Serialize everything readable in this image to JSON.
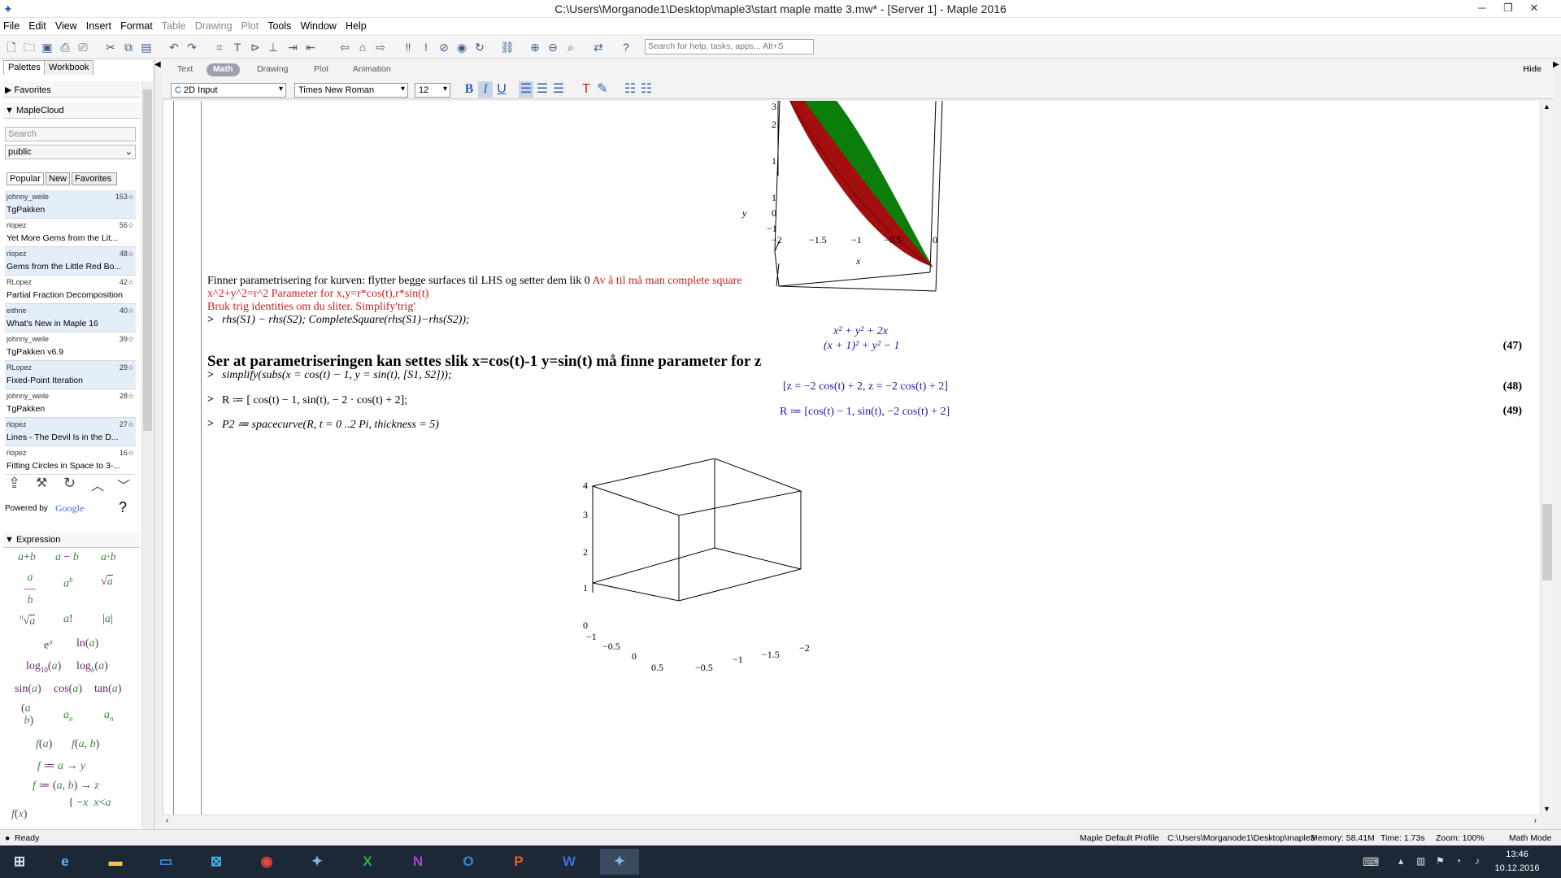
{
  "window": {
    "title": "C:\\Users\\Morganode1\\Desktop\\maple3\\start maple matte 3.mw* - [Server 1] - Maple 2016",
    "minimize": "─",
    "restore": "❐",
    "close": "✕"
  },
  "menu": [
    "File",
    "Edit",
    "View",
    "Insert",
    "Format",
    "Table",
    "Drawing",
    "Plot",
    "Tools",
    "Window",
    "Help"
  ],
  "toolbar": {
    "search_placeholder": "Search for help, tasks, apps... Alt+S"
  },
  "palette": {
    "tabs": [
      "Palettes",
      "Workbook"
    ],
    "favorites_label": "Favorites",
    "maplecloud_label": "MapleCloud",
    "search_placeholder": "Search",
    "group_select": "public",
    "cloud_tabs": [
      "Popular",
      "New",
      "Favorites"
    ],
    "cloud_items": [
      {
        "author": "johnny_weile",
        "count": "153",
        "name": "TgPakken"
      },
      {
        "author": "rlopez",
        "count": "56",
        "name": "Yet More Gems from the Lit..."
      },
      {
        "author": "rlopez",
        "count": "48",
        "name": "Gems from the Little Red Bo..."
      },
      {
        "author": "RLopez",
        "count": "42",
        "name": "Partial Fraction Decomposition"
      },
      {
        "author": "eithne",
        "count": "40",
        "name": "What's New in Maple 16"
      },
      {
        "author": "johnny_weile",
        "count": "39",
        "name": "TgPakken v6.9"
      },
      {
        "author": "RLopez",
        "count": "29",
        "name": "Fixed-Point Iteration"
      },
      {
        "author": "johnny_weile",
        "count": "28",
        "name": "TgPakken"
      },
      {
        "author": "rlopez",
        "count": "27",
        "name": "Lines - The Devil Is in the D..."
      },
      {
        "author": "rlopez",
        "count": "16",
        "name": "Fitting Circles in Space to 3-..."
      }
    ],
    "powered_by": "Powered by",
    "google": "Google",
    "help_mark": "?",
    "expression_label": "Expression"
  },
  "context": {
    "modes": [
      "Text",
      "Math",
      "Drawing",
      "Plot",
      "Animation"
    ],
    "active_mode": "Math",
    "hide_label": "Hide",
    "input_style": "2D Input",
    "font": "Times New Roman",
    "size": "12",
    "bold": "B",
    "italic": "I",
    "underline": "U"
  },
  "document": {
    "plot1": {
      "ylabel": "y",
      "xlabel": "x",
      "z_ticks": [
        "3",
        "2",
        "1"
      ],
      "y_ticks": [
        "1",
        "0",
        "−1"
      ],
      "x_ticks": [
        "−2",
        "−1.5",
        "−1",
        "−0.5",
        "0"
      ]
    },
    "text_line1_black": "Finner parametrisering for kurven: flytter begge surfaces til LHS og setter dem lik 0 ",
    "text_line1_red": "Av å til må man complete square",
    "text_line2": "x^2+y^2=r^2 Parameter for x,y=r*cos(t),r*sin(t)",
    "text_line3": "Bruk trig identities om du sliter. Simplify'trig'",
    "prompt_symbol": ">",
    "input1": "rhs(S1) − rhs(S2); CompleteSquare(rhs(S1)−rhs(S2));",
    "output1a": "x² + y² + 2x",
    "output1b": "(x + 1)² + y² − 1",
    "eq47": "(47)",
    "heading": "Ser at parametriseringen kan settes slik x=cos(t)-1    y=sin(t) må finne parameter for z",
    "input2": "simplify(subs(x = cos(t) − 1, y = sin(t), [S1, S2]));",
    "output2": "[z = −2 cos(t) + 2, z = −2 cos(t) + 2]",
    "eq48": "(48)",
    "input3": "R ≔ [ cos(t) − 1, sin(t), − 2 · cos(t) + 2];",
    "output3": "R ≔ [cos(t) − 1, sin(t), −2 cos(t) + 2]",
    "eq49": "(49)",
    "input4": "P2 ≔ spacecurve(R, t = 0 ..2 Pi, thickness = 5)",
    "plot2": {
      "z_ticks": [
        "4",
        "3",
        "2",
        "1",
        "0"
      ],
      "y_ticks": [
        "−1",
        "−0.5",
        "0",
        "0.5"
      ],
      "x_ticks": [
        "−0.5",
        "−1",
        "−1.5",
        "−2"
      ]
    }
  },
  "status": {
    "ready": "Ready",
    "profile": "Maple Default Profile",
    "path": "C:\\Users\\Morganode1\\Desktop\\maple3",
    "memory": "Memory: 58.41M",
    "time": "Time: 1.73s",
    "zoom": "Zoom: 100%",
    "mode": "Math Mode"
  },
  "taskbar": {
    "clock_time": "13:46",
    "clock_date": "10.12.2016"
  },
  "colors": {
    "surface_green": "#0b7d0b",
    "surface_red": "#a50e0e",
    "maple_blue": "#1a1aa8",
    "text_red": "#c81e1e"
  }
}
